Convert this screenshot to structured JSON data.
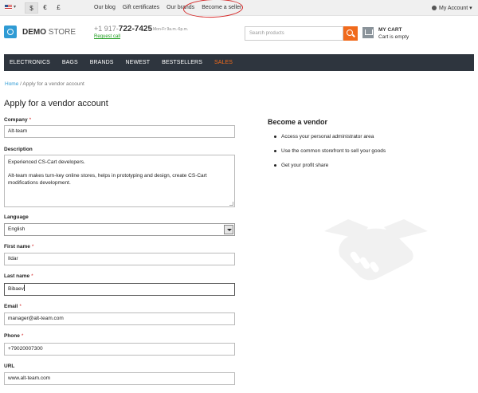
{
  "topbar": {
    "currencies": [
      "$",
      "€",
      "£"
    ],
    "links": [
      "Our blog",
      "Gift certificates",
      "Our brands",
      "Become a seller"
    ],
    "account": "My Account"
  },
  "header": {
    "logo_bold": "DEMO",
    "logo_light": "STORE",
    "phone_prefix": "+1 917-",
    "phone_main": "722-7425",
    "phone_hours": "Mon-Fr 9a.m.-6p.m.",
    "request_call": "Request call",
    "search_placeholder": "Search products",
    "cart_title": "MY CART",
    "cart_status": "Cart is empty"
  },
  "nav": [
    "ELECTRONICS",
    "BAGS",
    "BRANDS",
    "NEWEST",
    "BESTSELLERS",
    "SALES"
  ],
  "breadcrumb": {
    "home": "Home",
    "sep": "/",
    "current": "Apply for a vendor account"
  },
  "page_title": "Apply for a vendor account",
  "form": {
    "company": {
      "label": "Company",
      "value": "Alt-team"
    },
    "description": {
      "label": "Description",
      "line1": "Experienced CS-Cart developers.",
      "line2": "Alt-team makes turn-key online stores, helps in prototyping and design, create CS-Cart modifications development."
    },
    "language": {
      "label": "Language",
      "value": "English"
    },
    "first_name": {
      "label": "First name",
      "value": "Ildar"
    },
    "last_name": {
      "label": "Last name",
      "value": "Bibaev"
    },
    "email": {
      "label": "Email",
      "value": "manager@alt-team.com"
    },
    "phone": {
      "label": "Phone",
      "value": "+79020007300"
    },
    "url": {
      "label": "URL",
      "value": "www.alt-team.com"
    },
    "required_mark": "*"
  },
  "vendor_panel": {
    "title": "Become a vendor",
    "items": [
      "Access your personal administrator area",
      "Use the common storefront to sell your goods",
      "Get your profit share"
    ]
  }
}
